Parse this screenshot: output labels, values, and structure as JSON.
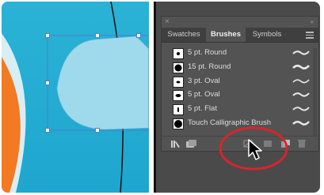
{
  "panel": {
    "close_glyph": "×",
    "collapse_glyph": "«",
    "tabs": [
      {
        "label": "Swatches",
        "active": false
      },
      {
        "label": "Brushes",
        "active": true
      },
      {
        "label": "Symbols",
        "active": false
      }
    ],
    "brushes": [
      {
        "label": "5 pt. Round",
        "tip": "round"
      },
      {
        "label": "15 pt. Round",
        "tip": "round"
      },
      {
        "label": "3 pt. Oval",
        "tip": "oval"
      },
      {
        "label": "5 pt. Oval",
        "tip": "oval"
      },
      {
        "label": "5 pt. Flat",
        "tip": "flat"
      },
      {
        "label": "Touch Calligraphic Brush",
        "tip": "round"
      }
    ],
    "bottom_icons": [
      "brush-libraries-icon",
      "libraries-panel-icon",
      "remove-brush-stroke-icon",
      "options-of-selected-object-icon",
      "new-brush-icon",
      "delete-brush-icon"
    ]
  },
  "colors": {
    "canvas_blue": "#1ea6cf",
    "shape_fill": "#9fd9ec",
    "orange": "#f27a22",
    "panel_bg": "#535353",
    "highlight_red": "#d9242b",
    "selection_blue": "#4a7fd1"
  }
}
